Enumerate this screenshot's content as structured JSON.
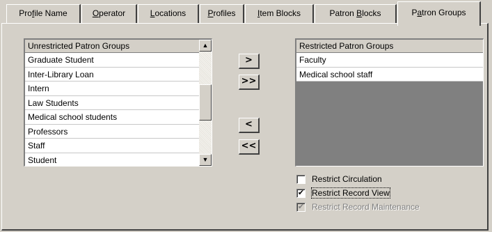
{
  "tabs": [
    {
      "pre": "Pro",
      "u": "f",
      "post": "ile Name"
    },
    {
      "pre": "",
      "u": "O",
      "post": "perator"
    },
    {
      "pre": "",
      "u": "L",
      "post": "ocations"
    },
    {
      "pre": "",
      "u": "P",
      "post": "rofiles"
    },
    {
      "pre": "",
      "u": "I",
      "post": "tem Blocks"
    },
    {
      "pre": "Patron ",
      "u": "B",
      "post": "locks"
    },
    {
      "pre": "P",
      "u": "a",
      "post": "tron Groups"
    }
  ],
  "active_tab": "Patron Groups",
  "unrestricted": {
    "header": "Unrestricted Patron Groups",
    "items": [
      "Graduate Student",
      "Inter-Library Loan",
      "Intern",
      "Law Students",
      "Medical school students",
      "Professors",
      "Staff",
      "Student"
    ]
  },
  "restricted": {
    "header": "Restricted Patron Groups",
    "items": [
      "Faculty",
      "Medical school staff"
    ]
  },
  "buttons": {
    "move_one_right": ">",
    "move_all_right": ">>",
    "move_one_left": "<",
    "move_all_left": "<<"
  },
  "scrollbar": {
    "up": "▲",
    "down": "▼"
  },
  "checkboxes": {
    "restrict_circulation": {
      "label": "Restrict Circulation",
      "checked": false,
      "enabled": true
    },
    "restrict_record_view": {
      "label": "Restrict Record View",
      "checked": true,
      "enabled": true
    },
    "restrict_record_maintenance": {
      "label": "Restrict Record Maintenance",
      "checked": true,
      "enabled": false
    }
  },
  "check_mark": "✔"
}
